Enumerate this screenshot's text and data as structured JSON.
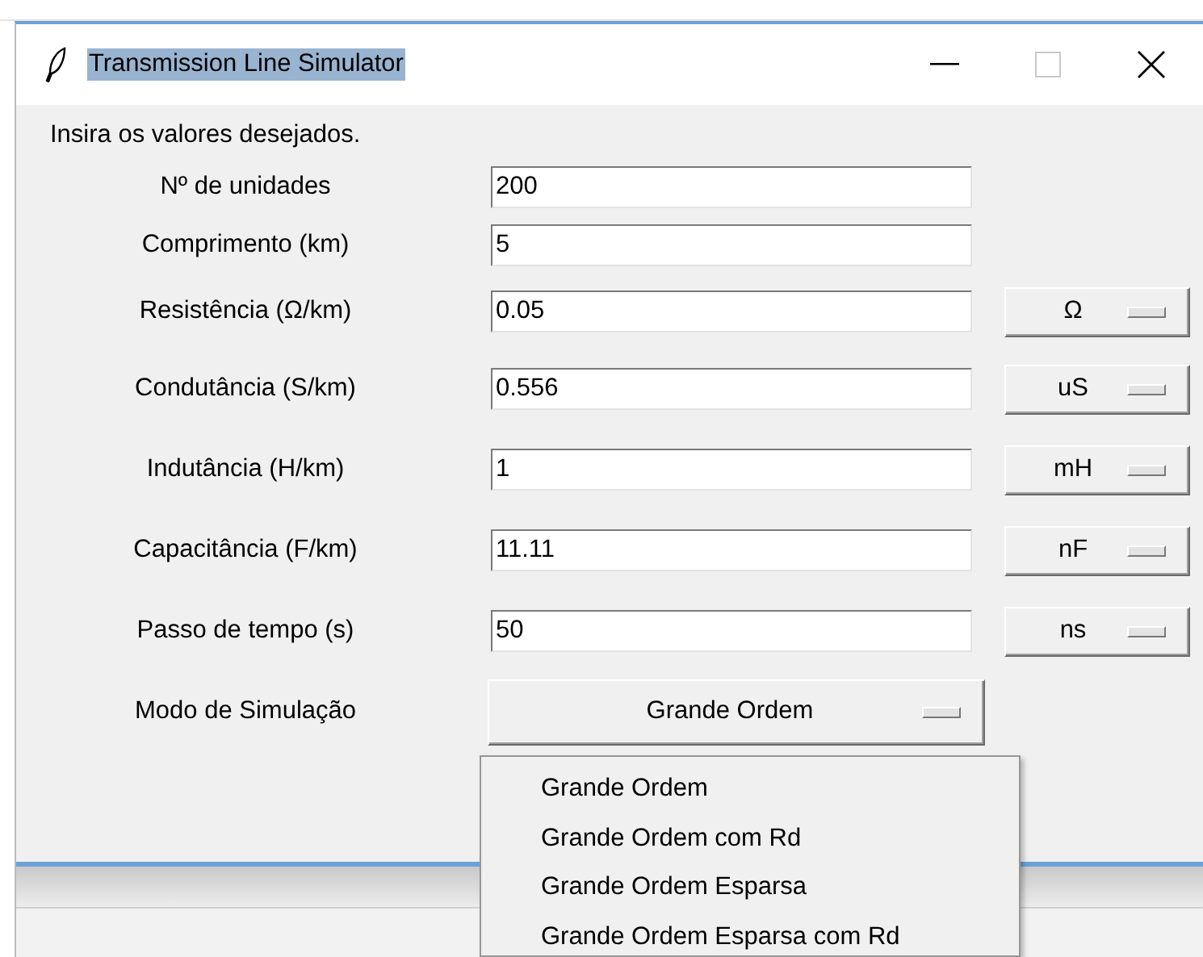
{
  "window": {
    "title": "Transmission Line Simulator"
  },
  "prompt": "Insira os valores desejados.",
  "fields": [
    {
      "label": "Nº de unidades",
      "value": "200"
    },
    {
      "label": "Comprimento (km)",
      "value": "5"
    },
    {
      "label": "Resistência (Ω/km)",
      "value": "0.05",
      "unit": "Ω"
    },
    {
      "label": "Condutância (S/km)",
      "value": "0.556",
      "unit": "uS"
    },
    {
      "label": "Indutância (H/km)",
      "value": "1",
      "unit": "mH"
    },
    {
      "label": "Capacitância (F/km)",
      "value": "11.11",
      "unit": "nF"
    },
    {
      "label": "Passo de tempo (s)",
      "value": "50",
      "unit": "ns"
    }
  ],
  "mode": {
    "label": "Modo de Simulação",
    "value": "Grande Ordem"
  },
  "mode_menu": [
    {
      "label": "Grande Ordem",
      "selected": false
    },
    {
      "label": "Grande Ordem com Rd",
      "selected": false
    },
    {
      "label": "Grande Ordem Esparsa",
      "selected": false
    },
    {
      "label": "Grande Ordem Esparsa com Rd",
      "selected": false
    }
  ]
}
